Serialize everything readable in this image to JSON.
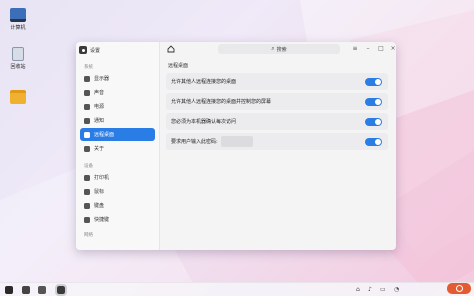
{
  "desktop": {
    "icons": [
      {
        "label": "计算机",
        "icon": "computer-icon"
      },
      {
        "label": "回收站",
        "icon": "trash-icon"
      },
      {
        "label": "",
        "icon": "folder-icon"
      }
    ]
  },
  "window": {
    "title": "设置",
    "search_placeholder": "搜索",
    "sidebar": {
      "groups": [
        {
          "label": "系统",
          "items": [
            {
              "label": "显示器",
              "icon": "display-icon",
              "active": false
            },
            {
              "label": "声音",
              "icon": "sound-icon",
              "active": false
            },
            {
              "label": "电源",
              "icon": "power-icon",
              "active": false
            },
            {
              "label": "通知",
              "icon": "notification-icon",
              "active": false
            },
            {
              "label": "远程桌面",
              "icon": "remote-desktop-icon",
              "active": true
            },
            {
              "label": "关于",
              "icon": "info-icon",
              "active": false
            }
          ]
        },
        {
          "label": "设备",
          "items": [
            {
              "label": "打印机",
              "icon": "printer-icon",
              "active": false
            },
            {
              "label": "鼠标",
              "icon": "mouse-icon",
              "active": false
            },
            {
              "label": "键盘",
              "icon": "keyboard-icon",
              "active": false
            },
            {
              "label": "快捷键",
              "icon": "shortcut-icon",
              "active": false
            }
          ]
        },
        {
          "label": "网络",
          "items": []
        }
      ]
    },
    "content": {
      "section_title": "远程桌面",
      "rows": [
        {
          "label": "允许其他人远程连接您的桌面",
          "enabled": true
        },
        {
          "label": "允许其他人远程连接您的桌面并控制您的屏幕",
          "enabled": true
        },
        {
          "label": "您必须为本机器确认每次访问",
          "enabled": true
        },
        {
          "label": "要求用户输入此密码:",
          "enabled": true,
          "has_password_field": true
        }
      ]
    },
    "controls": {
      "menu": "≡",
      "minimize": "–",
      "maximize": "□",
      "close": "×"
    }
  },
  "colors": {
    "accent": "#2b7de6"
  }
}
